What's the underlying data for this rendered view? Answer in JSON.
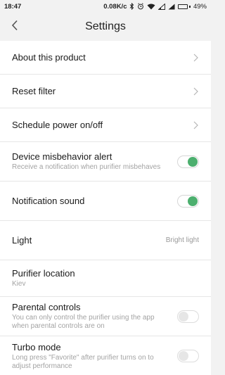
{
  "status_bar": {
    "time": "18:47",
    "speed": "0.08K/c",
    "battery": "49%",
    "battery_level": 0.49,
    "icons": [
      "bluetooth-icon",
      "alarm-icon",
      "wifi-icon",
      "signal-icon",
      "signal-icon",
      "battery-icon"
    ]
  },
  "header": {
    "title": "Settings",
    "back_icon": "chevron-left-icon"
  },
  "settings": {
    "about": {
      "title": "About this product"
    },
    "reset_filter": {
      "title": "Reset filter"
    },
    "schedule": {
      "title": "Schedule power on/off"
    },
    "misbehavior": {
      "title": "Device misbehavior alert",
      "subtitle": "Receive a notification when purifier misbehaves",
      "enabled": true
    },
    "notification_sound": {
      "title": "Notification sound",
      "enabled": true
    },
    "light": {
      "title": "Light",
      "value": "Bright light"
    },
    "location": {
      "title": "Purifier location",
      "value": "Kiev"
    },
    "parental": {
      "title": "Parental controls",
      "subtitle": "You can only control the purifier using the app when parental controls are on",
      "enabled": false
    },
    "turbo": {
      "title": "Turbo mode",
      "subtitle": "Long press \"Favorite\" after purifier turns on to adjust performance",
      "enabled": false
    }
  },
  "colors": {
    "accent_green": "#4caf6e",
    "background": "#f2f2f2",
    "divider": "#e6e6e6"
  }
}
